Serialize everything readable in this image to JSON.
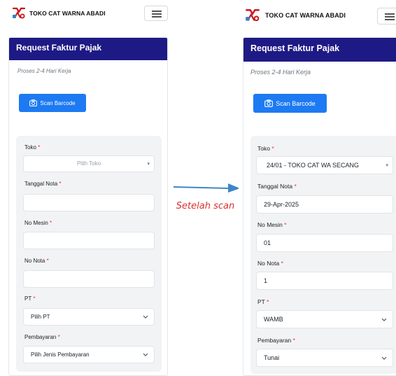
{
  "app": {
    "brand": "TOKO CAT WARNA ABADI"
  },
  "card": {
    "title": "Request Faktur Pajak",
    "subtitle": "Proses 2-4 Hari Kerja",
    "scan_button": "Scan Barcode"
  },
  "form_labels": {
    "toko": "Toko",
    "tanggal_nota": "Tanggal Nota",
    "no_mesin": "No Mesin",
    "no_nota": "No Nota",
    "pt": "PT",
    "pembayaran": "Pembayaran",
    "required_mark": "*"
  },
  "before": {
    "toko": "Pilih Toko",
    "tanggal_nota": "",
    "no_mesin": "",
    "no_nota": "",
    "pt": "Pilih PT",
    "pembayaran": "Pilih Jenis Pembayaran"
  },
  "after": {
    "toko": "24/01 - TOKO CAT WA SECANG",
    "tanggal_nota": "29-Apr-2025",
    "no_mesin": "01",
    "no_nota": "1",
    "pt": "WAMB",
    "pembayaran": "Tunai"
  },
  "transition_label": "Setelah scan",
  "colors": {
    "header": "#1e1a85",
    "button": "#1d7af2",
    "required": "#e3342f",
    "arrow": "#3d86c6",
    "transition_text": "#d9302e"
  }
}
